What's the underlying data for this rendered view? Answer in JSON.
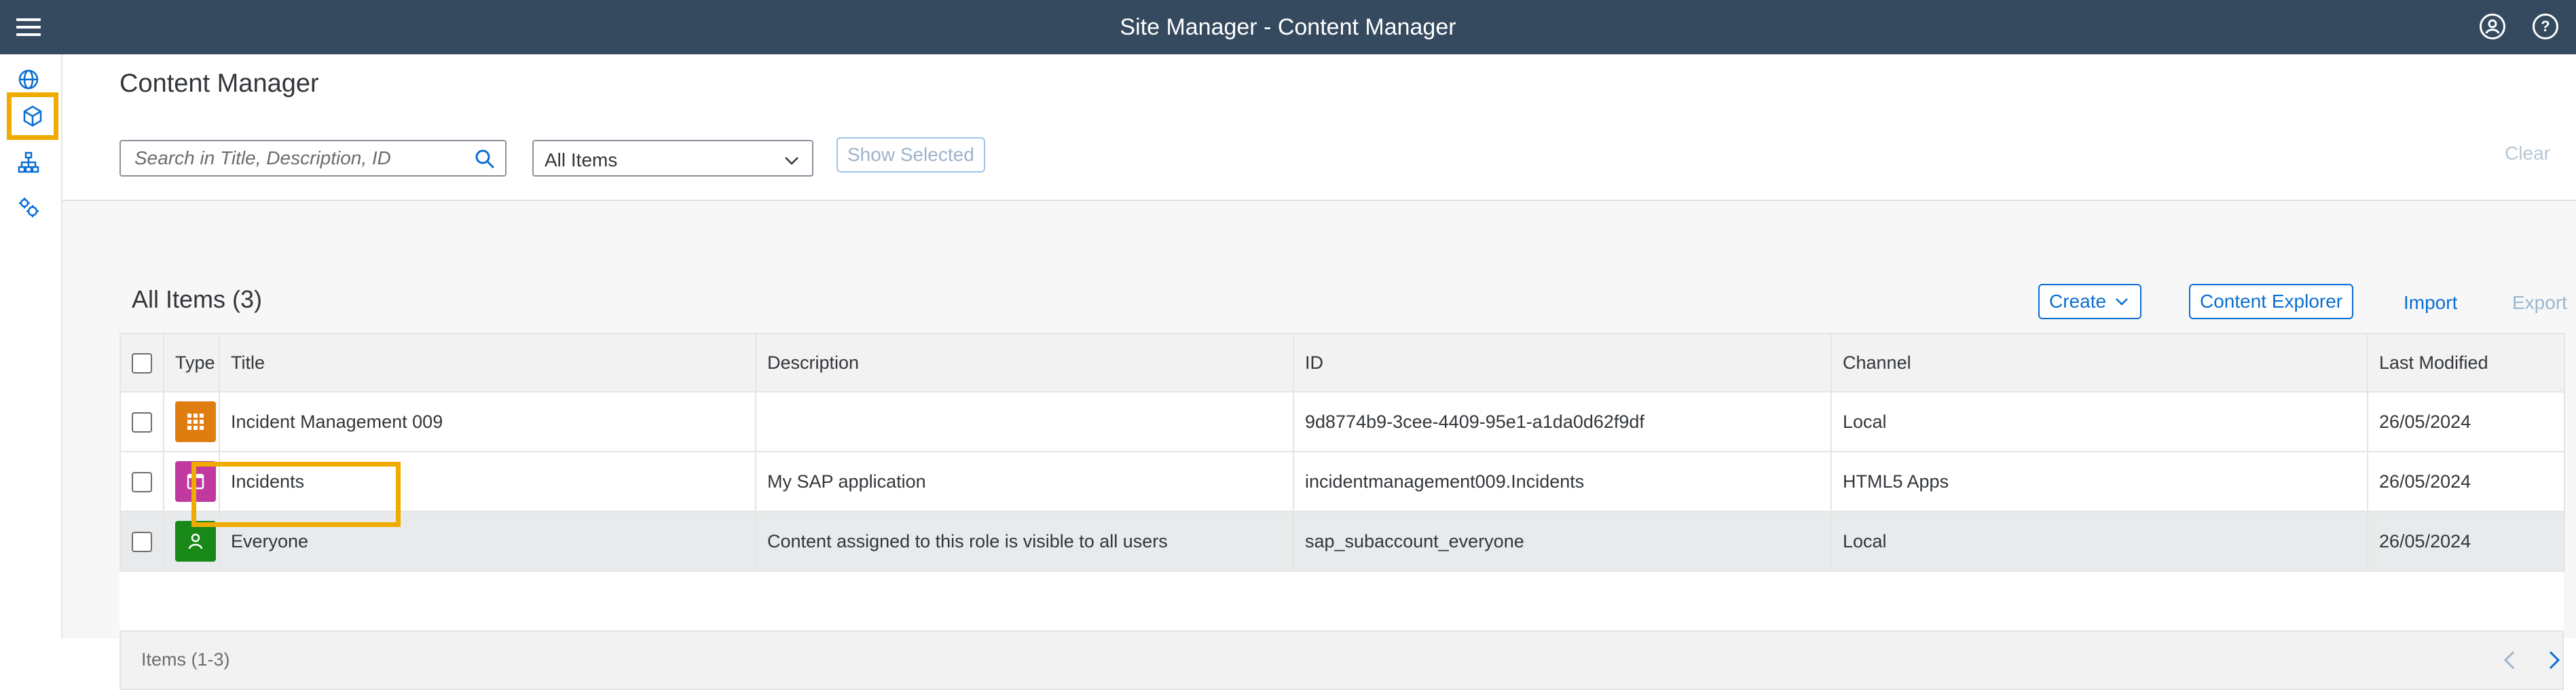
{
  "shell": {
    "title": "Site Manager - Content Manager",
    "menu_icon": "hamburger-icon",
    "user_icon": "user-icon",
    "help_icon": "help-icon",
    "help_glyph": "?"
  },
  "leftnav": {
    "items": [
      {
        "icon": "globe-icon"
      },
      {
        "icon": "cube-icon",
        "selected": true
      },
      {
        "icon": "hierarchy-icon"
      },
      {
        "icon": "settings-icon"
      }
    ],
    "highlight_color": "#f0ab00"
  },
  "header": {
    "title": "Content Manager",
    "search_placeholder": "Search in Title, Description, ID",
    "filter_value": "All Items",
    "show_selected_label": "Show Selected",
    "clear_label": "Clear"
  },
  "toolbar": {
    "title": "All Items (3)",
    "create_label": "Create",
    "content_explorer_label": "Content Explorer",
    "import_label": "Import",
    "export_label": "Export"
  },
  "table": {
    "columns": [
      "Type",
      "Title",
      "Description",
      "ID",
      "Channel",
      "Last Modified"
    ],
    "rows": [
      {
        "type_icon": "grid-icon",
        "type_color": "#e07d11",
        "title": "Incident Management 009",
        "description": "",
        "id": "9d8774b9-3cee-4409-95e1-a1da0d62f9df",
        "channel": "Local",
        "last_modified": "26/05/2024"
      },
      {
        "type_icon": "window-icon",
        "type_color": "#c0399f",
        "title": "Incidents",
        "description": "My SAP application",
        "id": "incidentmanagement009.Incidents",
        "channel": "HTML5 Apps",
        "last_modified": "26/05/2024"
      },
      {
        "type_icon": "role-icon",
        "type_color": "#188918",
        "title": "Everyone",
        "description": "Content assigned to this role is visible to all users",
        "id": "sap_subaccount_everyone",
        "channel": "Local",
        "last_modified": "26/05/2024",
        "selected": true
      }
    ],
    "footer": "Items (1-3)"
  },
  "colors": {
    "shell_bg": "#354a5f",
    "accent": "#0a6ed1",
    "highlight": "#f0ab00"
  }
}
